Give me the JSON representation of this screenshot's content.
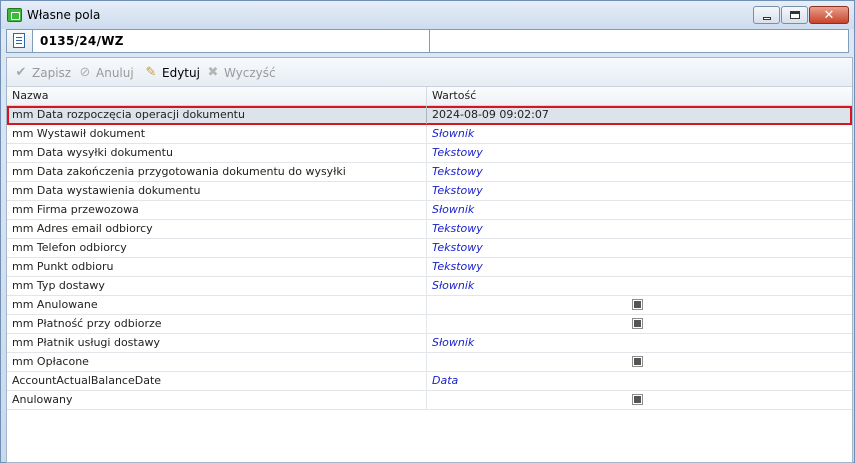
{
  "window": {
    "title": "Własne pola",
    "icon": "app-basket-icon"
  },
  "document": {
    "number": "0135/24/WZ",
    "icon": "document-icon"
  },
  "toolbar": {
    "save": {
      "label": "Zapisz",
      "icon": "checkmark-icon",
      "enabled": false
    },
    "cancel": {
      "label": "Anuluj",
      "icon": "cancel-icon",
      "enabled": false
    },
    "edit": {
      "label": "Edytuj",
      "icon": "pencil-icon",
      "enabled": true
    },
    "clear": {
      "label": "Wyczyść",
      "icon": "clear-x-icon",
      "enabled": false
    }
  },
  "grid": {
    "columns": [
      "Nazwa",
      "Wartość"
    ],
    "rows": [
      {
        "name": "mm Data rozpoczęcia operacji dokumentu",
        "value": "2024-08-09 09:02:07",
        "type": "text",
        "selected": true
      },
      {
        "name": "mm Wystawił dokument",
        "value": "Słownik",
        "type": "italic"
      },
      {
        "name": "mm Data wysyłki dokumentu",
        "value": "Tekstowy",
        "type": "italic"
      },
      {
        "name": "mm Data zakończenia przygotowania dokumentu do wysyłki",
        "value": "Tekstowy",
        "type": "italic"
      },
      {
        "name": "mm Data wystawienia dokumentu",
        "value": "Tekstowy",
        "type": "italic"
      },
      {
        "name": "mm Firma przewozowa",
        "value": "Słownik",
        "type": "italic"
      },
      {
        "name": "mm Adres email odbiorcy",
        "value": "Tekstowy",
        "type": "italic"
      },
      {
        "name": "mm Telefon odbiorcy",
        "value": "Tekstowy",
        "type": "italic"
      },
      {
        "name": "mm Punkt odbioru",
        "value": "Tekstowy",
        "type": "italic"
      },
      {
        "name": "mm Typ dostawy",
        "value": "Słownik",
        "type": "italic"
      },
      {
        "name": "mm Anulowane",
        "value": "",
        "type": "checkbox"
      },
      {
        "name": "mm Płatność przy odbiorze",
        "value": "",
        "type": "checkbox"
      },
      {
        "name": "mm Płatnik usługi dostawy",
        "value": "Słownik",
        "type": "italic"
      },
      {
        "name": "mm Opłacone",
        "value": "",
        "type": "checkbox"
      },
      {
        "name": "AccountActualBalanceDate",
        "value": "Data",
        "type": "italic"
      },
      {
        "name": "Anulowany",
        "value": "",
        "type": "checkbox"
      }
    ]
  },
  "colors": {
    "accent_selection_border": "#d8141c",
    "italic_value_text": "#1a22c8"
  }
}
